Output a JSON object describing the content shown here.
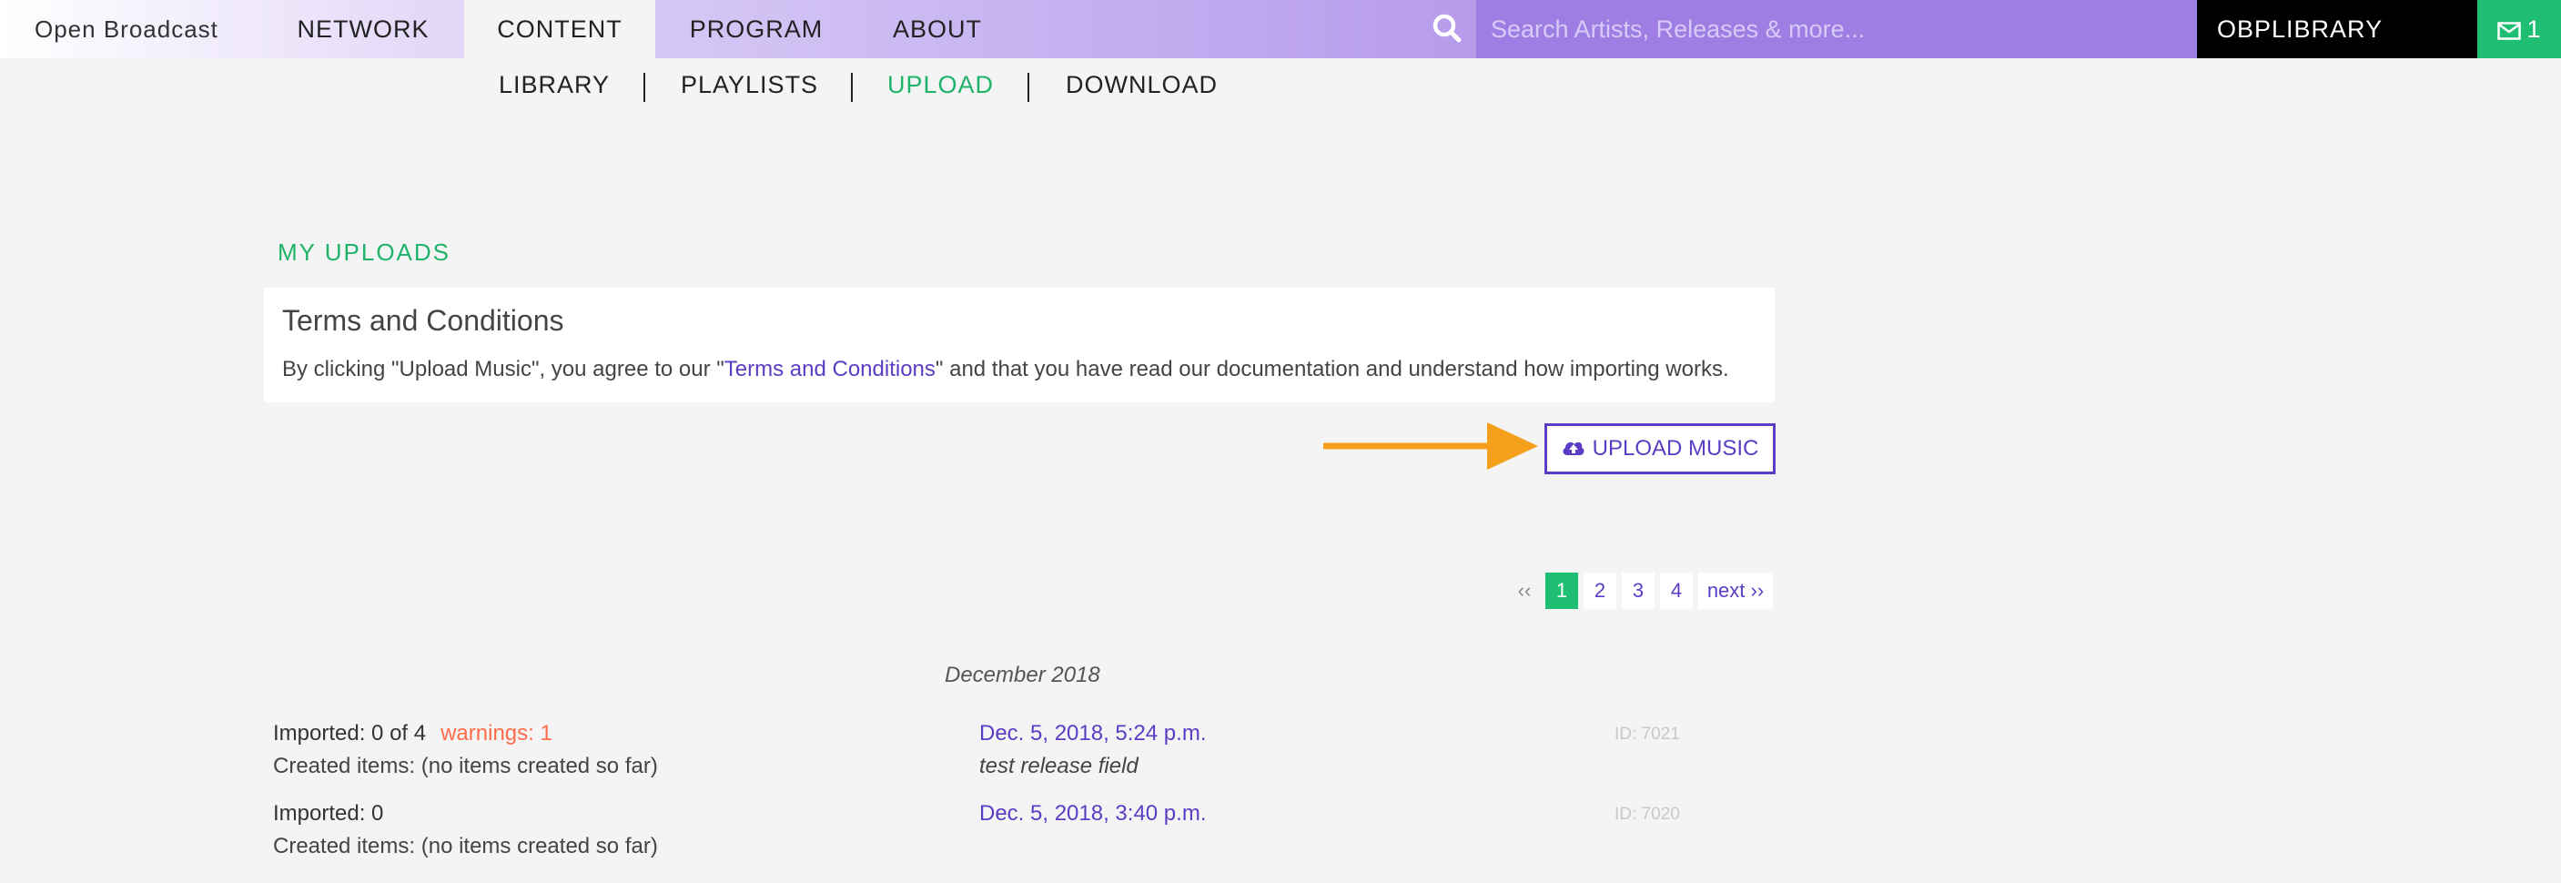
{
  "topnav": {
    "brand": "Open Broadcast",
    "items": [
      {
        "label": "NETWORK"
      },
      {
        "label": "CONTENT"
      },
      {
        "label": "PROGRAM"
      },
      {
        "label": "ABOUT"
      }
    ],
    "search_placeholder": "Search Artists, Releases & more...",
    "library_label": "OBPLIBRARY",
    "message_count": "1"
  },
  "subnav": {
    "items": [
      {
        "label": "LIBRARY"
      },
      {
        "label": "PLAYLISTS"
      },
      {
        "label": "UPLOAD"
      },
      {
        "label": "DOWNLOAD"
      }
    ],
    "active": "UPLOAD"
  },
  "main": {
    "section_title": "MY UPLOADS",
    "terms": {
      "title": "Terms and Conditions",
      "text_before": "By clicking \"Upload Music\", you agree to our \"",
      "link_text": "Terms and Conditions",
      "text_after": "\" and that you have read our documentation and understand how importing works."
    },
    "upload_button_label": "UPLOAD MUSIC",
    "pagination": {
      "prev": "‹‹",
      "pages": [
        "1",
        "2",
        "3",
        "4"
      ],
      "current": "1",
      "next": "next ››"
    },
    "month_label": "December 2018",
    "uploads": [
      {
        "imported": "Imported: 0 of 4",
        "warnings": "warnings: 1",
        "created": "Created items: (no items created so far)",
        "date": "Dec. 5, 2018, 5:24 p.m.",
        "note": "test release field",
        "id": "ID: 7021"
      },
      {
        "imported": "Imported: 0",
        "created": "Created items: (no items created so far)",
        "date": "Dec. 5, 2018, 3:40 p.m.",
        "id": "ID: 7020"
      }
    ]
  },
  "colors": {
    "accent_green": "#1fb36a",
    "accent_purple": "#5b3cc4",
    "warning": "#ff6b4a",
    "arrow": "#f5a01a"
  }
}
